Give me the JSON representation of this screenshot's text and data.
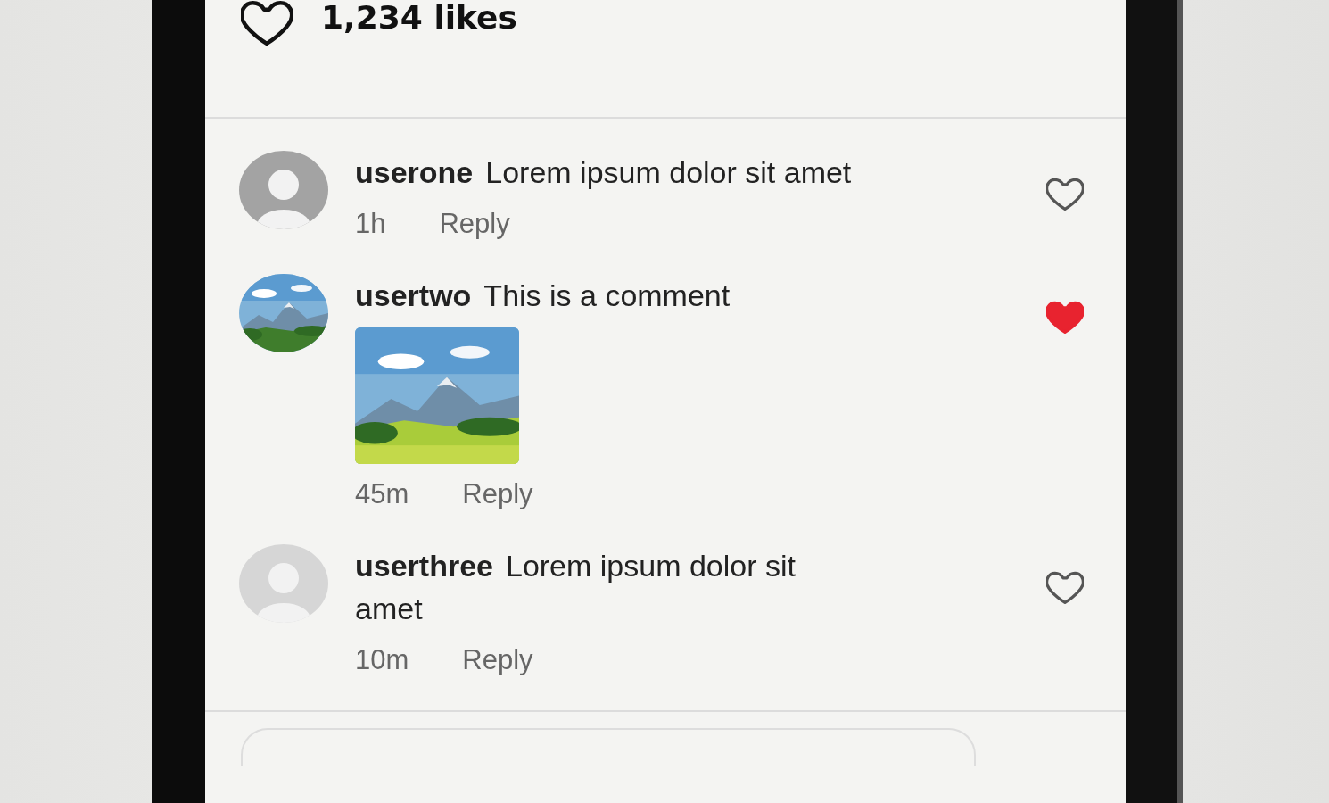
{
  "post": {
    "likes": "1,234 likes",
    "liked": false
  },
  "comments": [
    {
      "username": "userone",
      "text": "Lorem ipsum dolor sit amet",
      "avatar": {
        "kind": "placeholder",
        "color": "#a3a3a3"
      },
      "time": "1h",
      "reply": "Reply",
      "liked": false
    },
    {
      "username": "usertwo",
      "text": "This is a comment",
      "time": "45m",
      "reply": "Reply",
      "liked": true
    },
    {
      "username": "userthree",
      "text": "Lorem ipsum dolor sit amet",
      "avatar": {
        "kind": "placeholder",
        "color": "#d6d6d6"
      },
      "time": "10m",
      "reply": "Reply",
      "liked": false
    }
  ]
}
